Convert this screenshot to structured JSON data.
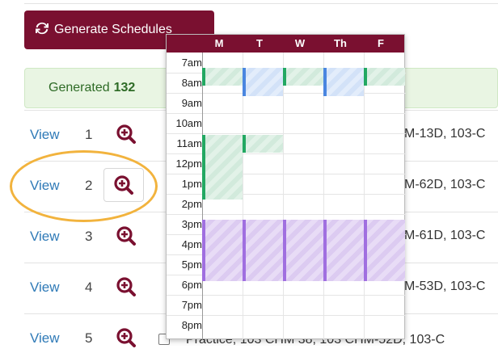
{
  "generate_button": {
    "label": "Generate Schedules"
  },
  "alert": {
    "prefix": "Generated",
    "count": "132"
  },
  "rows": [
    {
      "view": "View",
      "num": "1",
      "desc": "M-13D, 103-C"
    },
    {
      "view": "View",
      "num": "2",
      "desc": "M-62D, 103-C"
    },
    {
      "view": "View",
      "num": "3",
      "desc": "M-61D, 103-C"
    },
    {
      "view": "View",
      "num": "4",
      "desc": "M-53D, 103-C"
    },
    {
      "view": "View",
      "num": "5",
      "desc": "Practice, 103 CHM 38, 103 CHM-52D, 103-C"
    }
  ],
  "calendar": {
    "days": [
      "M",
      "T",
      "W",
      "Th",
      "F"
    ],
    "hours": [
      "7am",
      "8am",
      "9am",
      "10am",
      "11am",
      "12pm",
      "1pm",
      "2pm",
      "3pm",
      "4pm",
      "5pm",
      "6pm",
      "7pm",
      "8pm"
    ]
  },
  "colors": {
    "maroon": "#7a1030",
    "green": "#22a862",
    "blue": "#4a86e0",
    "purple": "#a06fe0",
    "highlight": "#f2b33d"
  },
  "icons": {
    "generate": "sync-icon",
    "zoom": "zoom-in-icon"
  }
}
